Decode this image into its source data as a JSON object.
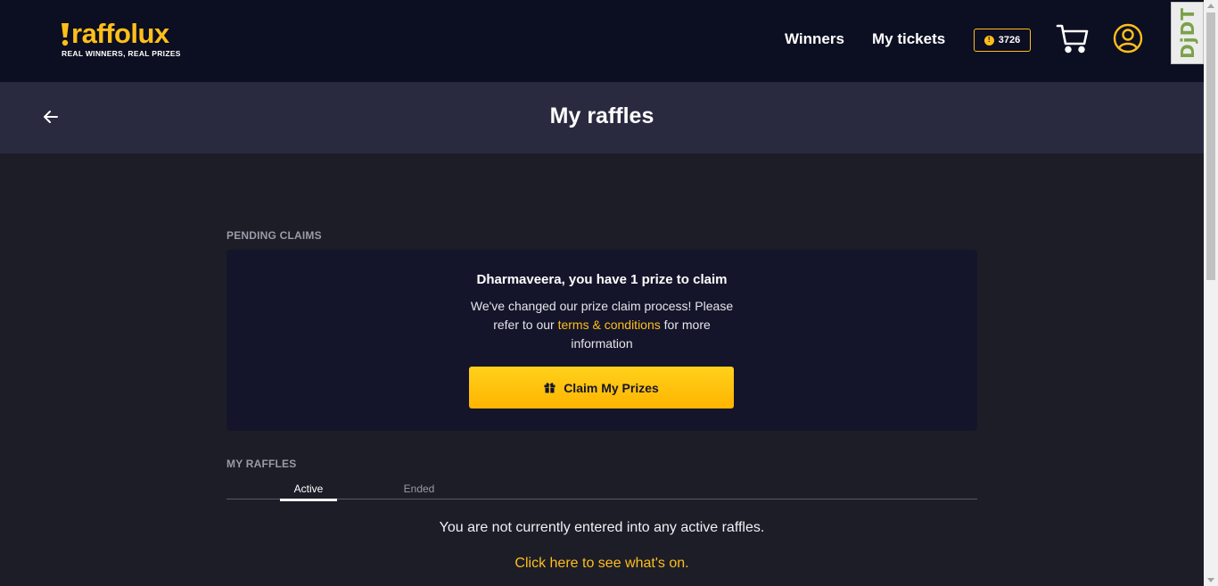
{
  "header": {
    "logo_text": "raffolux",
    "logo_tagline": "REAL WINNERS, REAL PRIZES",
    "nav": {
      "winners": "Winners",
      "my_tickets": "My tickets"
    },
    "coins": "3726",
    "coin_icon_glyph": "!",
    "icons": {
      "cart": "cart-icon",
      "user": "user-icon"
    },
    "accent": "#ffbf1a"
  },
  "debug_toolbar": {
    "label": "DjDT"
  },
  "subheader": {
    "title": "My raffles"
  },
  "pending_claims": {
    "section_label": "PENDING CLAIMS",
    "heading": "Dharmaveera, you have 1 prize to claim",
    "text_before": "We've changed our prize claim process! Please refer to our ",
    "link": "terms & conditions",
    "text_after": " for more information",
    "button": "Claim My Prizes"
  },
  "my_raffles": {
    "section_label": "MY RAFFLES",
    "tabs": [
      {
        "label": "Active",
        "selected": true
      },
      {
        "label": "Ended",
        "selected": false
      }
    ],
    "empty_message": "You are not currently entered into any active raffles.",
    "cta_link": "Click here to see what's on."
  }
}
